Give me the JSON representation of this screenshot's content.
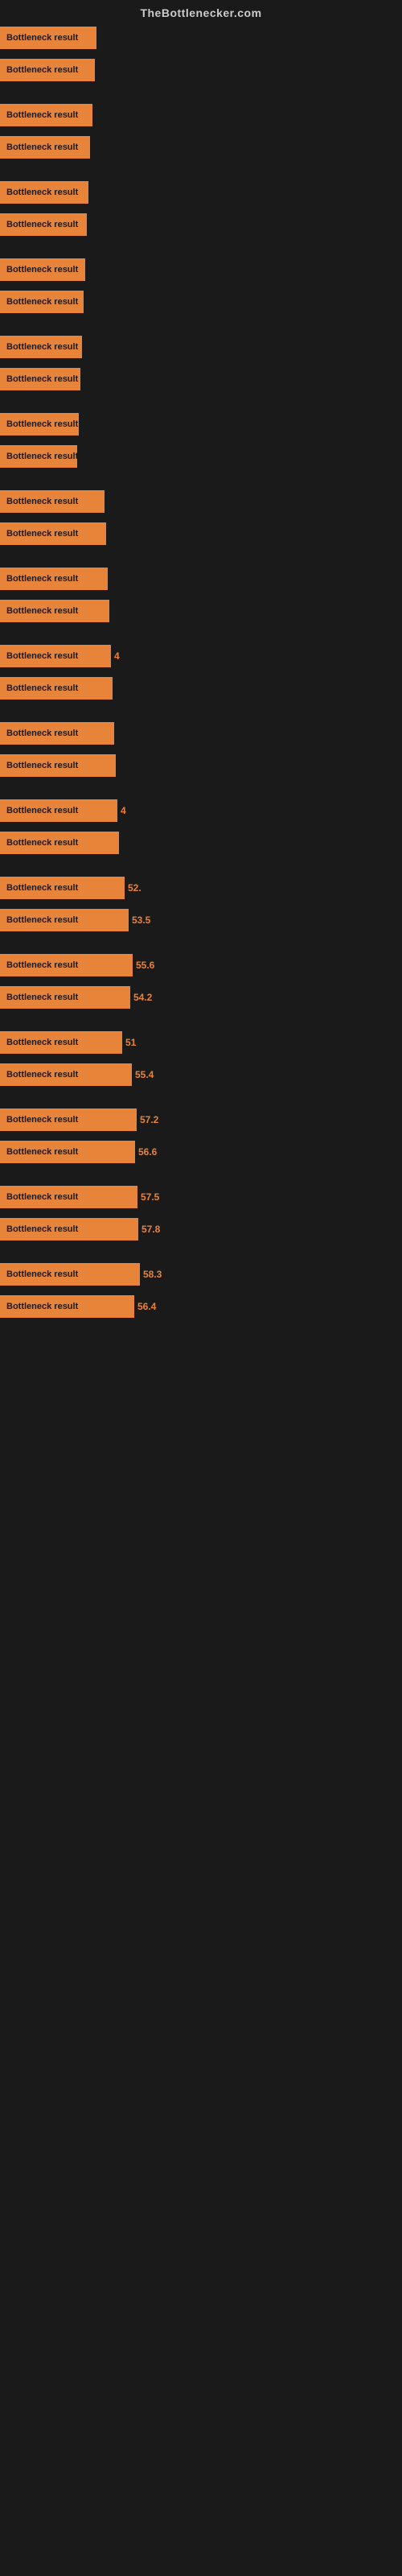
{
  "header": {
    "title": "TheBottlenecker.com"
  },
  "bars": [
    {
      "label": "Bottleneck result",
      "value": null,
      "width": 120
    },
    {
      "label": "Bottleneck result",
      "value": null,
      "width": 118
    },
    {
      "label": "Bottleneck result",
      "value": null,
      "width": 115
    },
    {
      "label": "Bottleneck result",
      "value": null,
      "width": 112
    },
    {
      "label": "Bottleneck result",
      "value": null,
      "width": 110
    },
    {
      "label": "Bottleneck result",
      "value": null,
      "width": 108
    },
    {
      "label": "Bottleneck result",
      "value": null,
      "width": 106
    },
    {
      "label": "Bottleneck result",
      "value": null,
      "width": 104
    },
    {
      "label": "Bottleneck result",
      "value": null,
      "width": 102
    },
    {
      "label": "Bottleneck result",
      "value": null,
      "width": 100
    },
    {
      "label": "Bottleneck result",
      "value": null,
      "width": 98
    },
    {
      "label": "Bottleneck result",
      "value": null,
      "width": 96
    },
    {
      "label": "Bottleneck result",
      "value": null,
      "width": 130
    },
    {
      "label": "Bottleneck result",
      "value": null,
      "width": 132
    },
    {
      "label": "Bottleneck result",
      "value": null,
      "width": 134
    },
    {
      "label": "Bottleneck result",
      "value": null,
      "width": 136
    },
    {
      "label": "Bottleneck result",
      "value": "4",
      "width": 138
    },
    {
      "label": "Bottleneck result",
      "value": null,
      "width": 140
    },
    {
      "label": "Bottleneck result",
      "value": null,
      "width": 142
    },
    {
      "label": "Bottleneck result",
      "value": null,
      "width": 144
    },
    {
      "label": "Bottleneck result",
      "value": "4",
      "width": 146
    },
    {
      "label": "Bottleneck result",
      "value": null,
      "width": 148
    },
    {
      "label": "Bottleneck result",
      "value": "52.",
      "width": 155
    },
    {
      "label": "Bottleneck result",
      "value": "53.5",
      "width": 160
    },
    {
      "label": "Bottleneck result",
      "value": "55.6",
      "width": 165
    },
    {
      "label": "Bottleneck result",
      "value": "54.2",
      "width": 162
    },
    {
      "label": "Bottleneck result",
      "value": "51",
      "width": 152
    },
    {
      "label": "Bottleneck result",
      "value": "55.4",
      "width": 164
    },
    {
      "label": "Bottleneck result",
      "value": "57.2",
      "width": 170
    },
    {
      "label": "Bottleneck result",
      "value": "56.6",
      "width": 168
    },
    {
      "label": "Bottleneck result",
      "value": "57.5",
      "width": 171
    },
    {
      "label": "Bottleneck result",
      "value": "57.8",
      "width": 172
    },
    {
      "label": "Bottleneck result",
      "value": "58.3",
      "width": 174
    },
    {
      "label": "Bottleneck result",
      "value": "56.4",
      "width": 167
    }
  ]
}
